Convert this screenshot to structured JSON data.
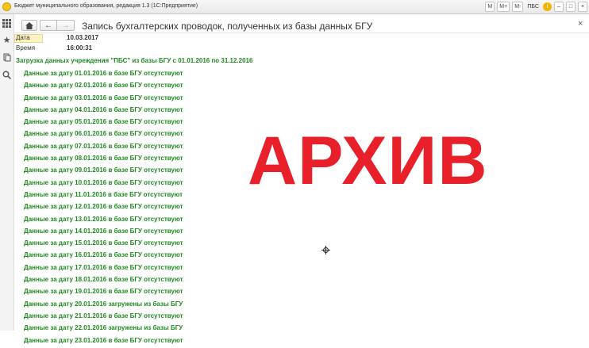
{
  "window": {
    "title": "Бюджет муниципального образования, редакция 1.3  (1С:Предприятие)",
    "right_buttons": [
      "M",
      "M+",
      "M-"
    ],
    "user": "ПБС",
    "info_icon": "i",
    "controls": [
      "–",
      "□",
      "×"
    ]
  },
  "left_panel": {
    "icons": [
      "apps-grid-icon",
      "favorites-star-icon",
      "history-icon",
      "search-icon"
    ]
  },
  "form": {
    "title": "Запись бухгалтерских проводок, полученных из базы данных БГУ",
    "close_glyph": "×",
    "date_label": "Дата",
    "date_value": "10.03.2017",
    "time_label": "Время",
    "time_value": "16:00:31"
  },
  "log": {
    "header": "Загрузка данных учреждения \"ПБС\" из базы БГУ с 01.01.2016 по 31.12.2016",
    "items": [
      "Данные за дату 01.01.2016 в базе БГУ отсутствуют",
      "Данные за дату 02.01.2016 в базе БГУ отсутствуют",
      "Данные за дату 03.01.2016 в базе БГУ отсутствуют",
      "Данные за дату 04.01.2016 в базе БГУ отсутствуют",
      "Данные за дату 05.01.2016 в базе БГУ отсутствуют",
      "Данные за дату 06.01.2016 в базе БГУ отсутствуют",
      "Данные за дату 07.01.2016 в базе БГУ отсутствуют",
      "Данные за дату 08.01.2016 в базе БГУ отсутствуют",
      "Данные за дату 09.01.2016 в базе БГУ отсутствуют",
      "Данные за дату 10.01.2016 в базе БГУ отсутствуют",
      "Данные за дату 11.01.2016 в базе БГУ отсутствуют",
      "Данные за дату 12.01.2016 в базе БГУ отсутствуют",
      "Данные за дату 13.01.2016 в базе БГУ отсутствуют",
      "Данные за дату 14.01.2016 в базе БГУ отсутствуют",
      "Данные за дату 15.01.2016 в базе БГУ отсутствуют",
      "Данные за дату 16.01.2016 в базе БГУ отсутствуют",
      "Данные за дату 17.01.2016 в базе БГУ отсутствуют",
      "Данные за дату 18.01.2016 в базе БГУ отсутствуют",
      "Данные за дату 19.01.2016 в базе БГУ отсутствуют",
      "Данные за дату 20.01.2016 загружены из базы БГУ",
      "Данные за дату 21.01.2016 в базе БГУ отсутствуют",
      "Данные за дату 22.01.2016 загружены из базы БГУ",
      "Данные за дату 23.01.2016 в базе БГУ отсутствуют"
    ]
  },
  "overlay": {
    "text": "АРХИВ",
    "color": "#e8202a"
  },
  "colors": {
    "log_green": "#1e8a1e"
  }
}
